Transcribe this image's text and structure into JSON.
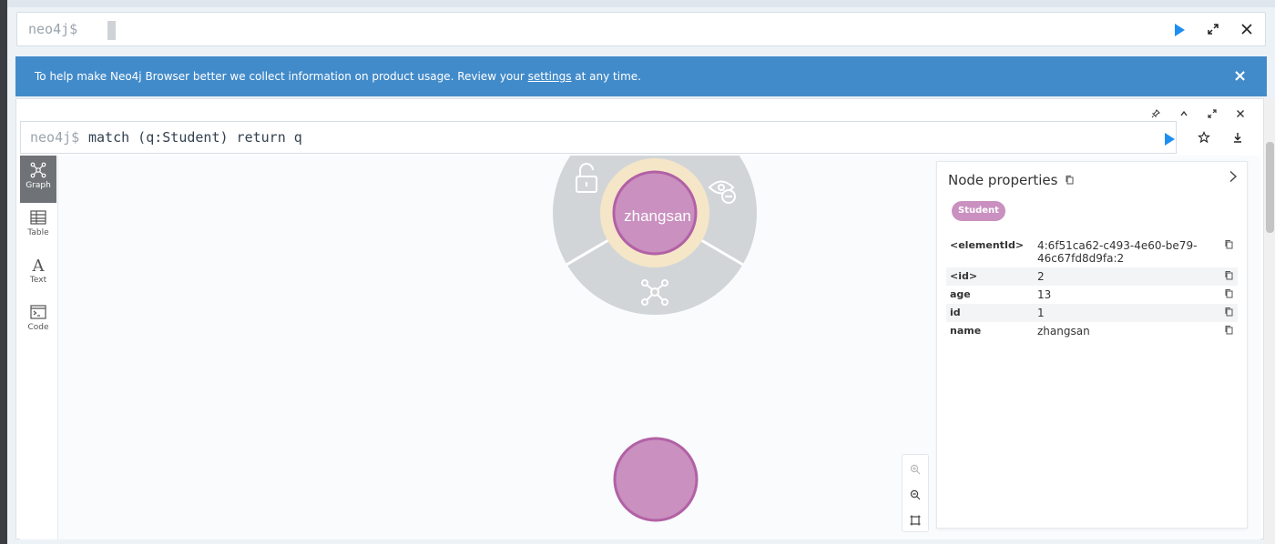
{
  "top_editor": {
    "prompt": "neo4j$"
  },
  "banner": {
    "text_before": "To help make Neo4j Browser better we collect information on product usage. Review your ",
    "link": "settings",
    "text_after": " at any time.",
    "close": "×"
  },
  "frame": {
    "prompt": "neo4j$",
    "query": "match (q:Student) return q"
  },
  "side_tabs": [
    {
      "label": "Graph",
      "icon": "graph-icon"
    },
    {
      "label": "Table",
      "icon": "table-icon"
    },
    {
      "label": "Text",
      "icon": "text-icon"
    },
    {
      "label": "Code",
      "icon": "code-icon"
    }
  ],
  "graph": {
    "selected_node": {
      "name": "zhangsan"
    },
    "node_color": "#c990c0",
    "node_border": "#b261a5",
    "ring_color": "#f5e6c8",
    "menu_color": "#d2d5d8"
  },
  "properties": {
    "title": "Node properties",
    "label": "Student",
    "rows": [
      {
        "key": "<elementId>",
        "value": "4:6f51ca62-c493-4e60-be79-46c67fd8d9fa:2"
      },
      {
        "key": "<id>",
        "value": "2"
      },
      {
        "key": "age",
        "value": "13"
      },
      {
        "key": "id",
        "value": "1"
      },
      {
        "key": "name",
        "value": "zhangsan"
      }
    ]
  }
}
